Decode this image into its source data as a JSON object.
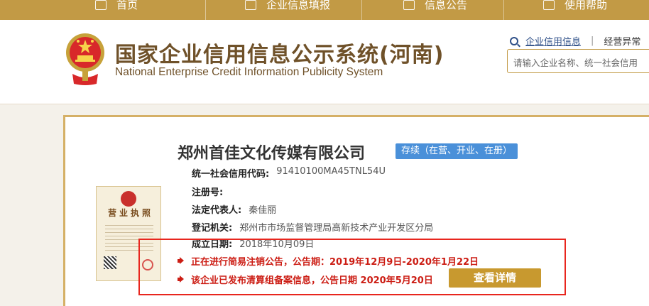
{
  "nav": {
    "items": [
      {
        "label": "首页",
        "icon": "home-icon"
      },
      {
        "label": "企业信息填报",
        "icon": "edit-icon"
      },
      {
        "label": "信息公告",
        "icon": "notice-icon"
      },
      {
        "label": "使用帮助",
        "icon": "help-icon"
      }
    ]
  },
  "header": {
    "title": "国家企业信用信息公示系统(河南)",
    "subtitle": "National Enterprise Credit Information Publicity System",
    "search_tab_active": "企业信用信息",
    "search_tab_divider": "|",
    "search_tab_other": "经营异常",
    "search_placeholder": "请输入企业名称、统一社会信用"
  },
  "company": {
    "name": "郑州首佳文化传媒有限公司",
    "status": "存续（在营、开业、在册）",
    "license_title": "营业执照",
    "fields": [
      {
        "label": "统一社会信用代码:",
        "value": "91410100MA45TNL54U"
      },
      {
        "label": "注册号:",
        "value": ""
      },
      {
        "label": "法定代表人:",
        "value": "秦佳丽"
      },
      {
        "label": "登记机关:",
        "value": "郑州市市场监督管理局高新技术产业开发区分局"
      },
      {
        "label": "成立日期:",
        "value": "2018年10月09日"
      }
    ]
  },
  "notices": [
    {
      "text": "正在进行简易注销公告，公告期：2019年12月9日-2020年1月22日"
    },
    {
      "text": "该企业已发布清算组备案信息，公告日期 2020年5月20日"
    }
  ],
  "detail_button_label": "查看详情",
  "colors": {
    "nav_bg": "#c29a45",
    "title_brown": "#6f5129",
    "badge_blue": "#4a90d9",
    "notice_red": "#cc1d14",
    "button_gold": "#c8992f"
  }
}
